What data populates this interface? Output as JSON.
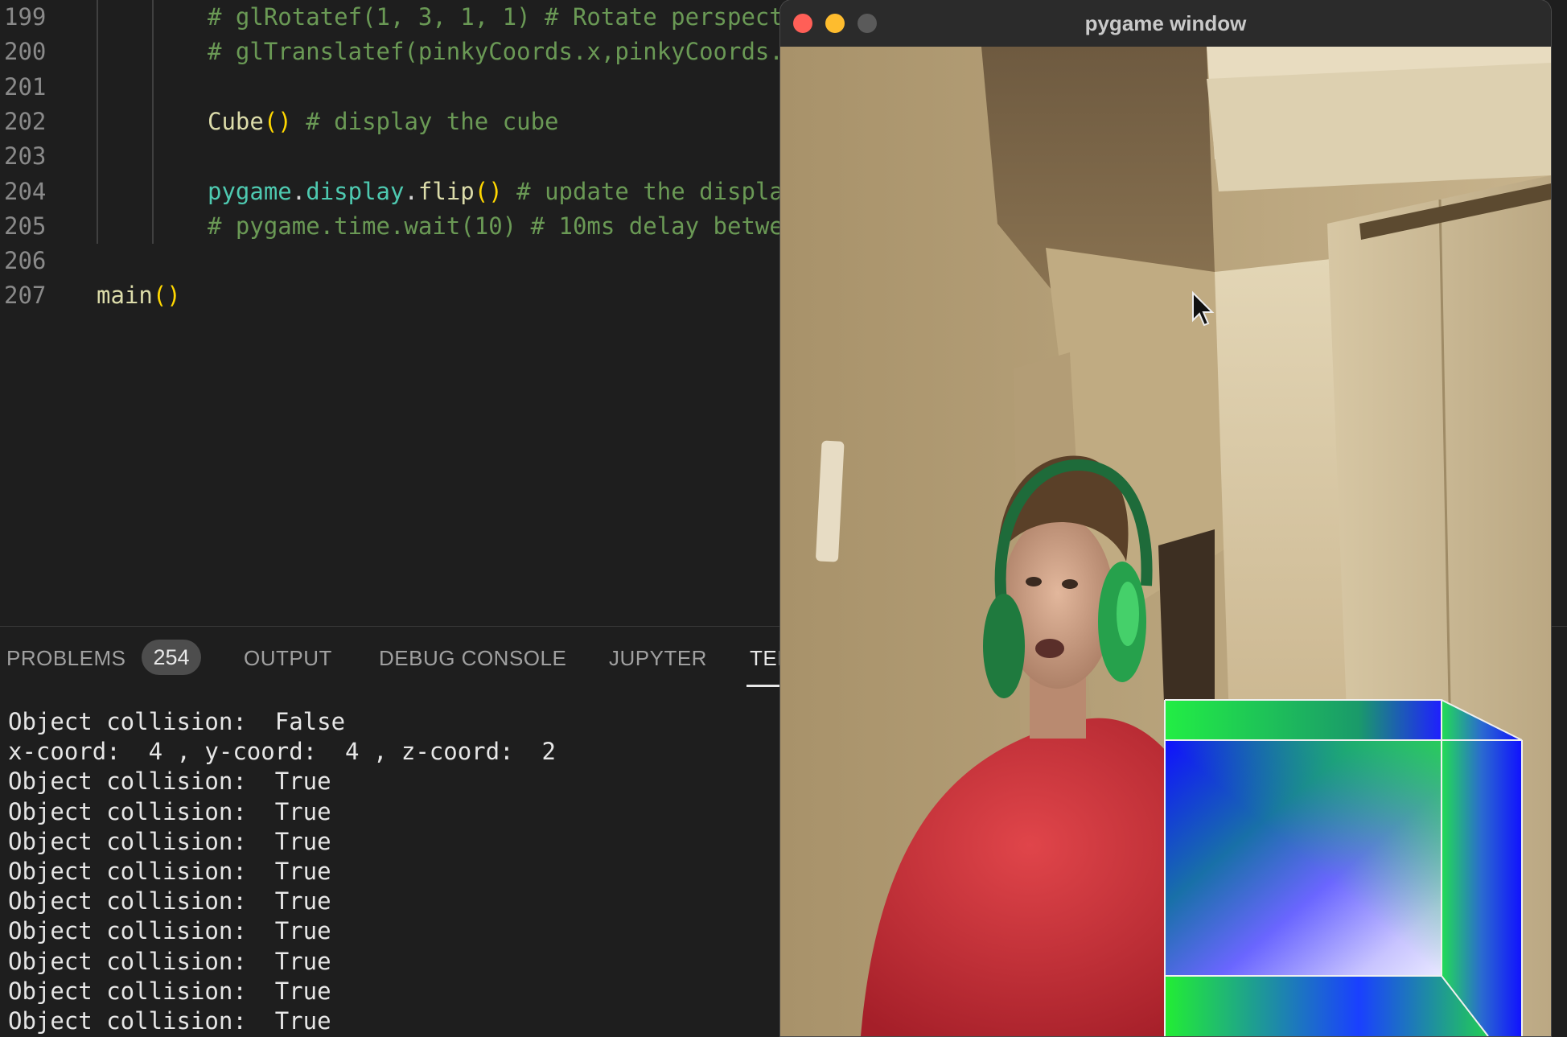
{
  "editor": {
    "lines": [
      {
        "num": "199",
        "tokens": [
          {
            "t": "# glRotatef(1, 3, 1, 1) # Rotate perspect",
            "c": "c-comment"
          }
        ],
        "indent": 2
      },
      {
        "num": "200",
        "tokens": [
          {
            "t": "# glTranslatef(pinkyCoords.x,pinkyCoords.",
            "c": "c-comment"
          }
        ],
        "indent": 2
      },
      {
        "num": "201",
        "tokens": [],
        "indent": 2
      },
      {
        "num": "202",
        "tokens": [
          {
            "t": "Cube",
            "c": "c-fn"
          },
          {
            "t": "()",
            "c": "c-paren"
          },
          {
            "t": " # display the cube",
            "c": "c-comment"
          }
        ],
        "indent": 2
      },
      {
        "num": "203",
        "tokens": [],
        "indent": 2
      },
      {
        "num": "204",
        "tokens": [
          {
            "t": "pygame",
            "c": "c-mod"
          },
          {
            "t": ".",
            "c": "c-plain"
          },
          {
            "t": "display",
            "c": "c-mod"
          },
          {
            "t": ".",
            "c": "c-plain"
          },
          {
            "t": "flip",
            "c": "c-fn"
          },
          {
            "t": "()",
            "c": "c-paren"
          },
          {
            "t": " # update the displa",
            "c": "c-comment"
          }
        ],
        "indent": 2
      },
      {
        "num": "205",
        "tokens": [
          {
            "t": "# pygame.time.wait(10) # 10ms delay betwe",
            "c": "c-comment"
          }
        ],
        "indent": 2
      },
      {
        "num": "206",
        "tokens": [],
        "indent": 0
      },
      {
        "num": "207",
        "tokens": [
          {
            "t": "main",
            "c": "c-fn"
          },
          {
            "t": "()",
            "c": "c-paren"
          }
        ],
        "indent": 0
      }
    ]
  },
  "panel": {
    "tabs": {
      "problems": "PROBLEMS",
      "problems_count": "254",
      "output": "OUTPUT",
      "debug_console": "DEBUG CONSOLE",
      "jupyter": "JUPYTER",
      "terminal": "TEI"
    },
    "terminal_lines": [
      "Object collision:  False",
      "x-coord:  4 , y-coord:  4 , z-coord:  2",
      "Object collision:  True",
      "Object collision:  True",
      "Object collision:  True",
      "Object collision:  True",
      "Object collision:  True",
      "Object collision:  True",
      "Object collision:  True",
      "Object collision:  True",
      "Object collision:  True"
    ]
  },
  "pygame": {
    "title": "pygame window"
  },
  "colors": {
    "accent_red": "#ff5f57",
    "accent_yellow": "#febc2e",
    "cube_blue": "#1a1aff",
    "cube_green": "#22ee33"
  }
}
